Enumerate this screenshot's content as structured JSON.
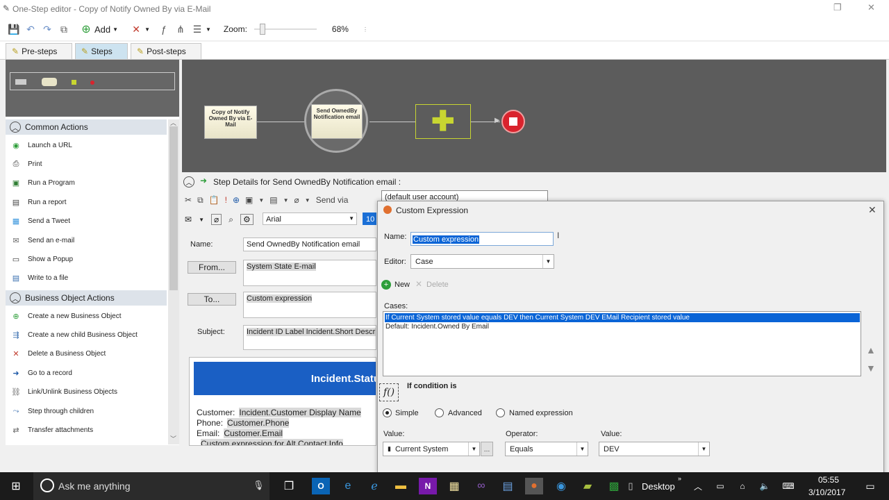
{
  "window": {
    "title": "One-Step editor - Copy of Notify Owned By via E-Mail"
  },
  "toolbar": {
    "add_label": "Add",
    "zoom_label": "Zoom:",
    "zoom_value": "68%",
    "zoom_level": 0.68
  },
  "tabs": [
    {
      "label": "Pre-steps"
    },
    {
      "label": "Steps"
    },
    {
      "label": "Post-steps"
    }
  ],
  "sidebar": {
    "common_title": "Common Actions",
    "common_items": [
      {
        "label": "Launch a URL",
        "icon": "globe-icon"
      },
      {
        "label": "Print",
        "icon": "printer-icon"
      },
      {
        "label": "Run a Program",
        "icon": "program-icon"
      },
      {
        "label": "Run a report",
        "icon": "report-icon"
      },
      {
        "label": "Send a Tweet",
        "icon": "tweet-icon"
      },
      {
        "label": "Send an e-mail",
        "icon": "email-icon"
      },
      {
        "label": "Show a Popup",
        "icon": "popup-icon"
      },
      {
        "label": "Write to a file",
        "icon": "file-icon"
      }
    ],
    "bo_title": "Business Object Actions",
    "bo_items": [
      {
        "label": "Create a new Business Object",
        "icon": "plus-circle-icon"
      },
      {
        "label": "Create a new child Business Object",
        "icon": "child-icon"
      },
      {
        "label": "Delete a Business Object",
        "icon": "x-icon"
      },
      {
        "label": "Go to a record",
        "icon": "goto-icon"
      },
      {
        "label": "Link/Unlink Business Objects",
        "icon": "link-icon"
      },
      {
        "label": "Step through children",
        "icon": "children-icon"
      },
      {
        "label": "Transfer attachments",
        "icon": "transfer-icon"
      }
    ]
  },
  "canvas": {
    "node1": "Copy of Notify Owned By via E-Mail",
    "node2": "Send OwnedBy Notification email"
  },
  "details": {
    "title": "Step Details for Send OwnedBy Notification email :",
    "send_via_label": "Send via",
    "send_via_value": "(default user account)",
    "font_value": "Arial",
    "font_size": "10",
    "name_label": "Name:",
    "name_value": "Send OwnedBy Notification email",
    "from_button": "From...",
    "from_value": "System State E-mail",
    "to_button": "To...",
    "to_value": "Custom expression",
    "subject_label": "Subject:",
    "subject_value": "Incident ID Label Incident.Short Descrip",
    "body_header": "Incident.Statu",
    "body_lines": [
      {
        "label": "Customer:",
        "value": "Incident.Customer Display Name"
      },
      {
        "label": "Phone:",
        "value": "Customer.Phone"
      },
      {
        "label": "Email:",
        "value": "Customer.Email"
      },
      {
        "label": "",
        "value": "Custom expression for Alt Contact Info"
      }
    ]
  },
  "dialog": {
    "title": "Custom Expression",
    "name_label": "Name:",
    "name_value": "Custom expression",
    "editor_label": "Editor:",
    "editor_value": "Case",
    "new_label": "New",
    "delete_label": "Delete",
    "cases_label": "Cases:",
    "cases": [
      "If Current System stored value equals DEV then Current System DEV EMail Recipient stored value",
      "Default: Incident.Owned By Email"
    ],
    "condition_title": "If condition is",
    "modes": [
      "Simple",
      "Advanced",
      "Named expression"
    ],
    "selected_mode": "Simple",
    "value_label": "Value:",
    "value_value": "Current System",
    "operator_label": "Operator:",
    "operator_value": "Equals",
    "value2_label": "Value:",
    "value2_value": "DEV"
  },
  "taskbar": {
    "search_placeholder": "Ask me anything",
    "desktop_label": "Desktop",
    "time": "05:55",
    "date": "3/10/2017"
  },
  "colors": {
    "accent": "#0078d7",
    "selection": "#0a64d6",
    "email_header": "#1a5fc4",
    "stop": "#d9232d",
    "add_node": "#c8d631"
  }
}
